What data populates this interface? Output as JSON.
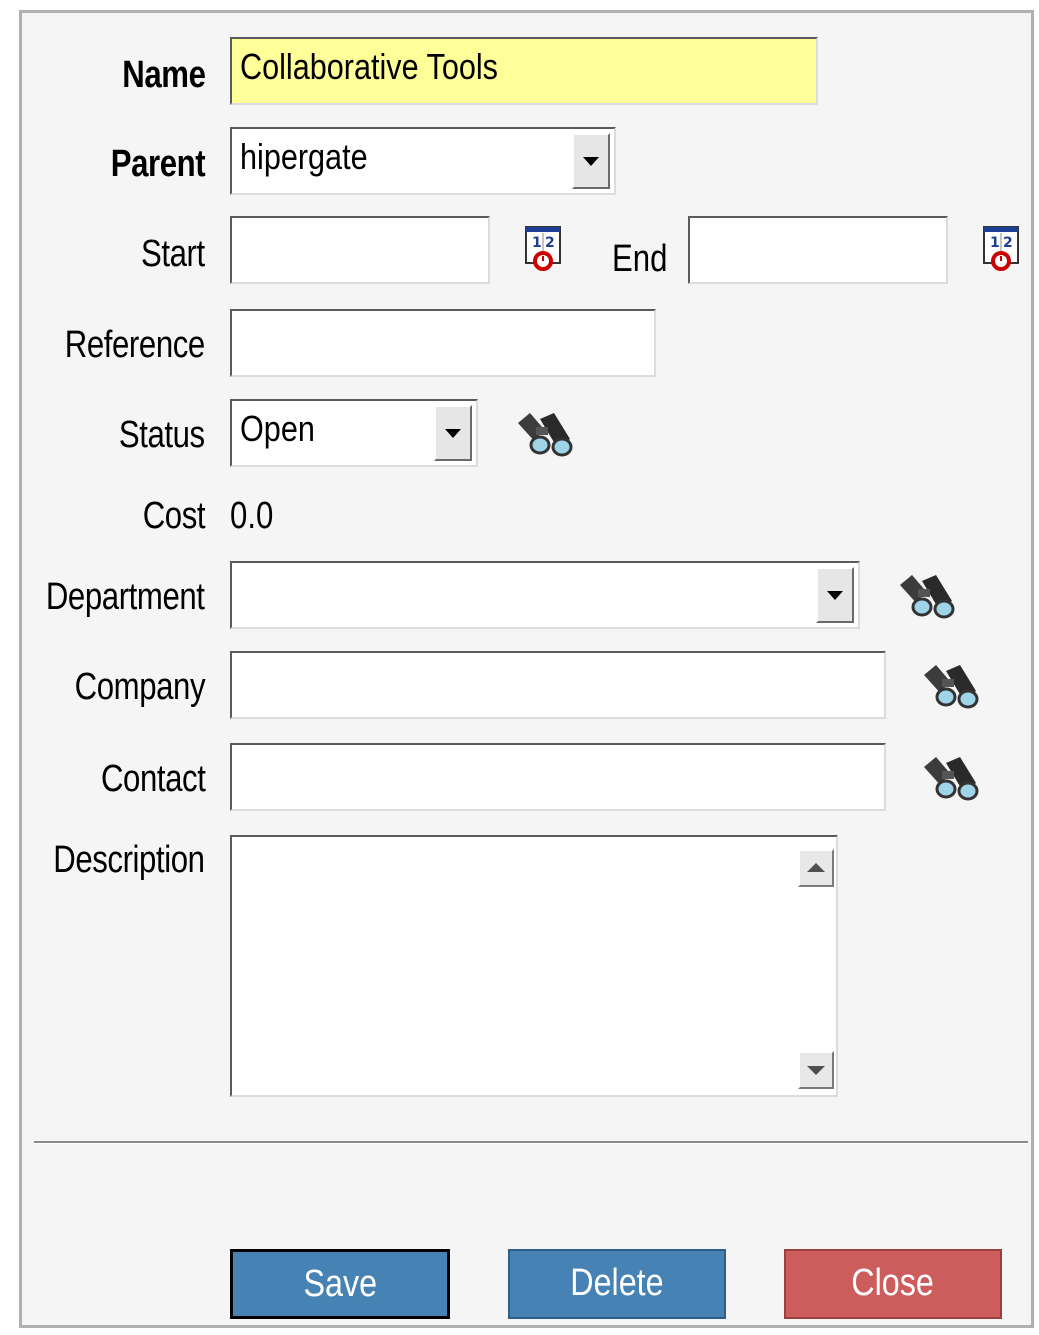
{
  "form": {
    "name": {
      "label": "Name",
      "value": "Collaborative Tools"
    },
    "parent": {
      "label": "Parent",
      "value": "hipergate"
    },
    "start": {
      "label": "Start",
      "value": ""
    },
    "end": {
      "label": "End",
      "value": ""
    },
    "reference": {
      "label": "Reference",
      "value": ""
    },
    "status": {
      "label": "Status",
      "value": "Open"
    },
    "cost": {
      "label": "Cost",
      "value": "0.0"
    },
    "department": {
      "label": "Department",
      "value": ""
    },
    "company": {
      "label": "Company",
      "value": ""
    },
    "contact": {
      "label": "Contact",
      "value": ""
    },
    "description": {
      "label": "Description",
      "value": ""
    }
  },
  "buttons": {
    "save": "Save",
    "delete": "Delete",
    "close": "Close"
  },
  "icons": {
    "calendar": "calendar-icon",
    "lookup": "binoculars-icon"
  },
  "colors": {
    "name_highlight": "#ffff99",
    "button_blue": "#4682b4",
    "button_red": "#cd5c5c",
    "panel_bg": "#f5f5f5"
  }
}
